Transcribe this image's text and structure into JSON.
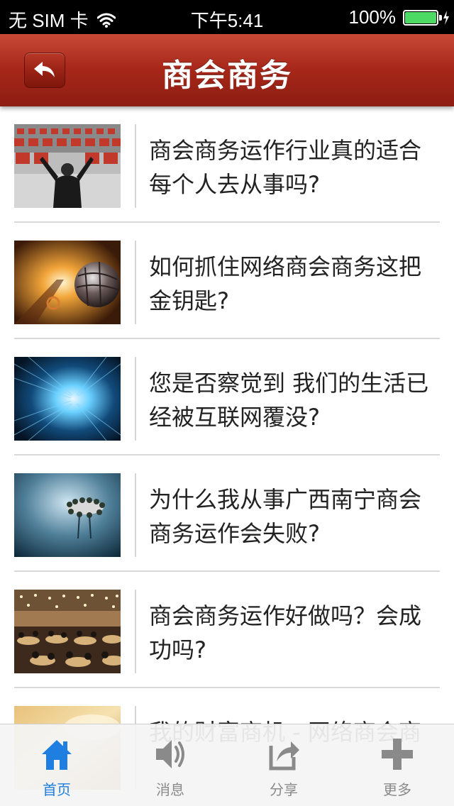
{
  "status_bar": {
    "carrier": "无 SIM 卡",
    "time": "下午5:41",
    "battery": "100%",
    "battery_color": "#4cd964"
  },
  "navbar": {
    "title": "商会商务",
    "back_icon": "back-arrow-icon",
    "color": "#a8281a"
  },
  "articles": [
    {
      "title": "商会商务运作行业真的适合每个人去从事吗?",
      "thumbnail": "office-monitors-photo"
    },
    {
      "title": "如何抓住网络商会商务这把金钥匙?",
      "thumbnail": "globe-at-sign-photo"
    },
    {
      "title": "您是否察觉到 我们的生活已经被互联网覆没?",
      "thumbnail": "binary-tunnel-photo"
    },
    {
      "title": "为什么我从事广西南宁商会商务运作会失败?",
      "thumbnail": "floating-meeting-photo"
    },
    {
      "title": "商会商务运作好做吗？会成功吗?",
      "thumbnail": "banquet-hall-photo"
    },
    {
      "title": "我的财富商机 - 网络商会商",
      "thumbnail": "gold-photo"
    }
  ],
  "tabbar": {
    "tabs": [
      {
        "label": "首页",
        "icon": "home-icon",
        "active": true
      },
      {
        "label": "消息",
        "icon": "speaker-icon",
        "active": false
      },
      {
        "label": "分享",
        "icon": "share-icon",
        "active": false
      },
      {
        "label": "更多",
        "icon": "plus-icon",
        "active": false
      }
    ],
    "active_color": "#1f7fe0",
    "inactive_color": "#8a8a8a"
  }
}
